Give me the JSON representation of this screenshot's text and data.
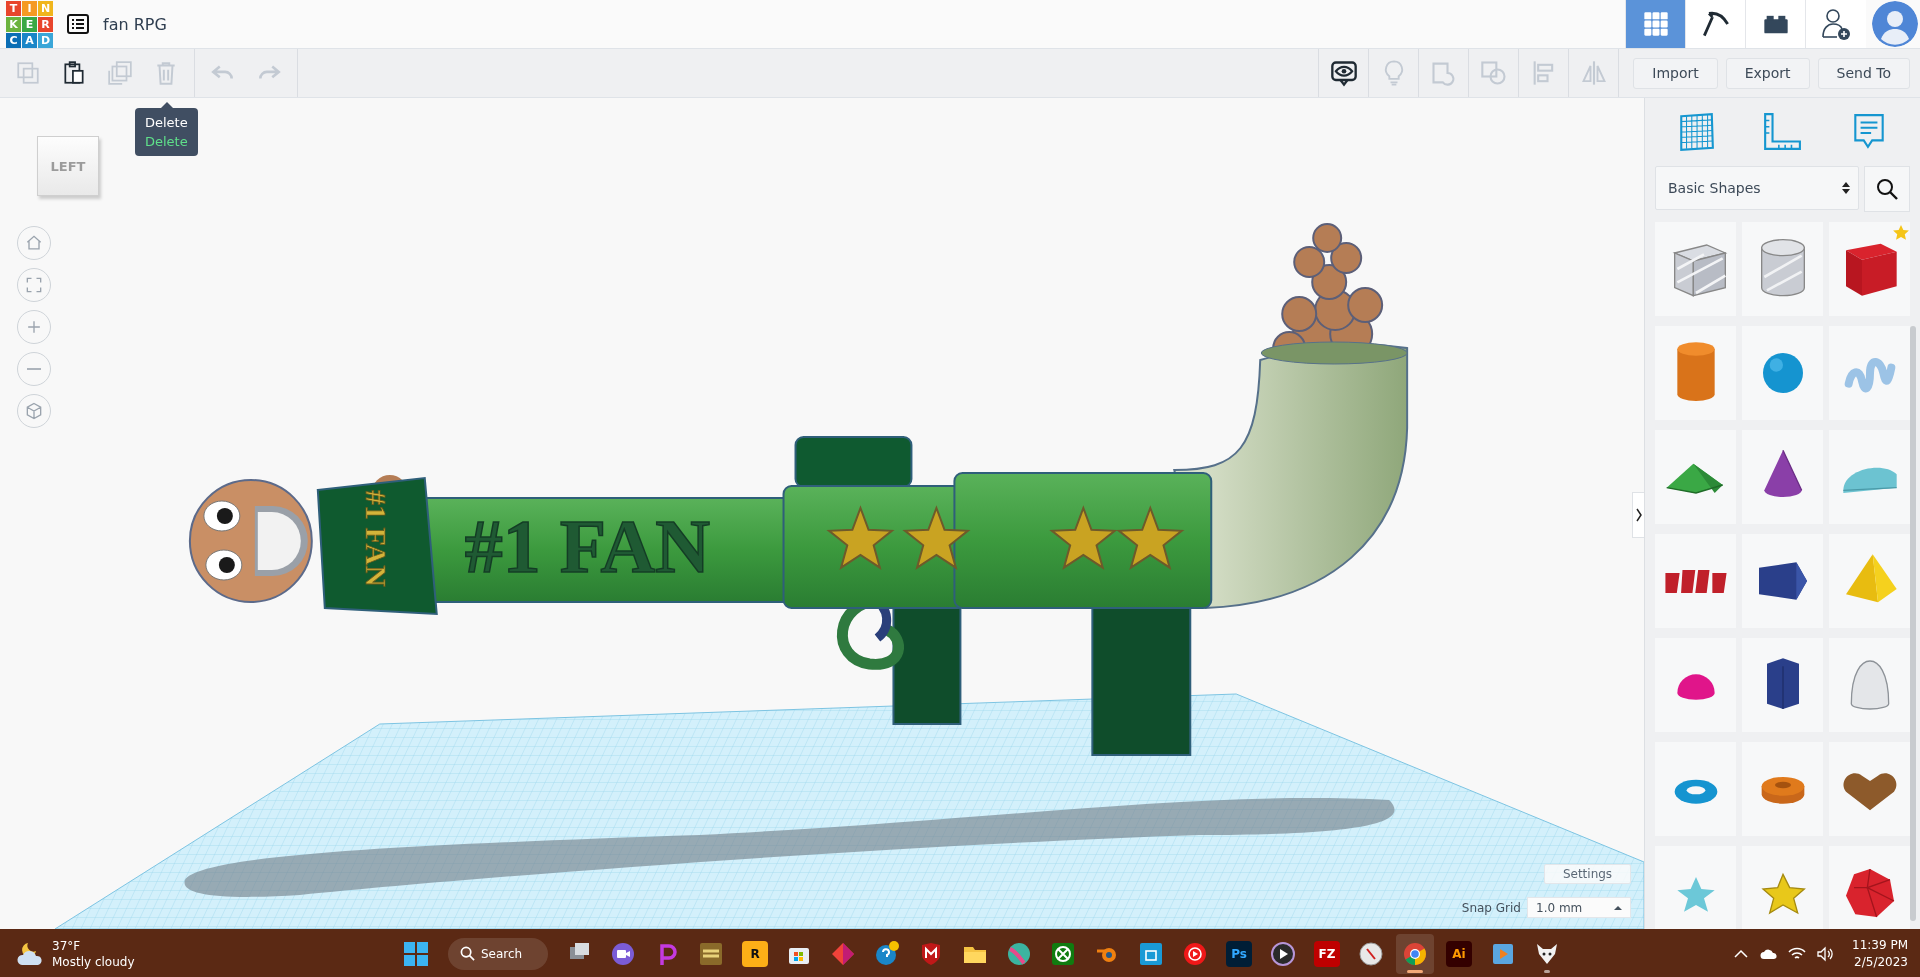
{
  "header": {
    "logo_letters": [
      "T",
      "I",
      "N",
      "K",
      "E",
      "R",
      "C",
      "A",
      "D"
    ],
    "title": "fan RPG",
    "tabs": [
      {
        "kind": "design",
        "selected": true
      },
      {
        "kind": "pickaxe",
        "selected": false
      },
      {
        "kind": "brick",
        "selected": false
      }
    ]
  },
  "toolbar": {
    "edit_tools": [
      {
        "kind": "copy",
        "disabled": true
      },
      {
        "kind": "paste",
        "disabled": false
      },
      {
        "kind": "duplicate",
        "disabled": true
      },
      {
        "kind": "delete",
        "disabled": true
      }
    ],
    "history_tools": [
      {
        "kind": "undo",
        "disabled": true
      },
      {
        "kind": "redo",
        "disabled": true
      }
    ],
    "view_tools": [
      {
        "kind": "eye",
        "disabled": false
      },
      {
        "kind": "bulb",
        "disabled": true
      },
      {
        "kind": "group",
        "disabled": true
      },
      {
        "kind": "ungroup",
        "disabled": true
      },
      {
        "kind": "align",
        "disabled": true
      },
      {
        "kind": "mirror",
        "disabled": true
      }
    ],
    "buttons": [
      "Import",
      "Export",
      "Send To"
    ]
  },
  "tooltip": {
    "title": "Delete",
    "shortcut": "Delete"
  },
  "viewcube": {
    "face": "LEFT"
  },
  "nav": [
    {
      "kind": "home"
    },
    {
      "kind": "fit"
    },
    {
      "kind": "zoom-in"
    },
    {
      "kind": "zoom-out"
    },
    {
      "kind": "perspective"
    }
  ],
  "model": {
    "barrel_text": "#1 FAN",
    "shirt_text": "#1 FAN"
  },
  "workplane": {
    "settings": "Settings",
    "snap_label": "Snap Grid",
    "snap_value": "1.0 mm"
  },
  "sidebar": {
    "tools": [
      {
        "kind": "workplane"
      },
      {
        "kind": "ruler"
      },
      {
        "kind": "notes"
      }
    ],
    "category": "Basic Shapes",
    "shapes": [
      {
        "kind": "box-hole",
        "favorite": false
      },
      {
        "kind": "cylinder-hole",
        "favorite": false
      },
      {
        "kind": "box",
        "favorite": true
      },
      {
        "kind": "cylinder",
        "favorite": false
      },
      {
        "kind": "sphere",
        "favorite": false
      },
      {
        "kind": "scribble",
        "favorite": false
      },
      {
        "kind": "roof",
        "favorite": false
      },
      {
        "kind": "cone",
        "favorite": false
      },
      {
        "kind": "round-roof",
        "favorite": false
      },
      {
        "kind": "text",
        "favorite": false
      },
      {
        "kind": "polygon",
        "favorite": false
      },
      {
        "kind": "pyramid",
        "favorite": false
      },
      {
        "kind": "half-sphere",
        "favorite": false
      },
      {
        "kind": "prism",
        "favorite": false
      },
      {
        "kind": "paraboloid",
        "favorite": false
      },
      {
        "kind": "torus",
        "favorite": false
      },
      {
        "kind": "tube",
        "favorite": false
      },
      {
        "kind": "heart",
        "favorite": false
      },
      {
        "kind": "star",
        "favorite": false
      },
      {
        "kind": "star-thick",
        "favorite": false
      },
      {
        "kind": "icosahedron",
        "favorite": false
      }
    ]
  },
  "taskbar": {
    "weather": {
      "temperature": "37°F",
      "condition": "Mostly cloudy"
    },
    "search": "Search",
    "apps": [
      {
        "kind": "taskview",
        "selected": false,
        "open": false
      },
      {
        "kind": "video",
        "selected": false,
        "open": false
      },
      {
        "kind": "p-app",
        "selected": false,
        "open": false
      },
      {
        "kind": "game",
        "selected": false,
        "open": false
      },
      {
        "kind": "rockstar",
        "label": "R",
        "selected": false,
        "open": false
      },
      {
        "kind": "store",
        "selected": false,
        "open": false
      },
      {
        "kind": "diamond",
        "selected": false,
        "open": false
      },
      {
        "kind": "help",
        "selected": false,
        "open": false
      },
      {
        "kind": "shield",
        "selected": false,
        "open": false
      },
      {
        "kind": "folder",
        "selected": false,
        "open": false
      },
      {
        "kind": "ball",
        "selected": false,
        "open": false
      },
      {
        "kind": "xbox",
        "selected": false,
        "open": false
      },
      {
        "kind": "blender",
        "selected": false,
        "open": false
      },
      {
        "kind": "bag",
        "selected": false,
        "open": false
      },
      {
        "kind": "music",
        "selected": false,
        "open": false
      },
      {
        "kind": "ps",
        "label": "Ps",
        "selected": false,
        "open": false
      },
      {
        "kind": "player",
        "selected": false,
        "open": false
      },
      {
        "kind": "fz",
        "label": "FZ",
        "selected": false,
        "open": false
      },
      {
        "kind": "compass",
        "selected": false,
        "open": false
      },
      {
        "kind": "chrome",
        "selected": true,
        "open": true
      },
      {
        "kind": "ai",
        "label": "Ai",
        "selected": false,
        "open": false
      },
      {
        "kind": "media",
        "selected": false,
        "open": false
      },
      {
        "kind": "fox",
        "selected": false,
        "open": true
      }
    ],
    "clock": {
      "time": "11:39 PM",
      "date": "2/5/2023"
    }
  }
}
